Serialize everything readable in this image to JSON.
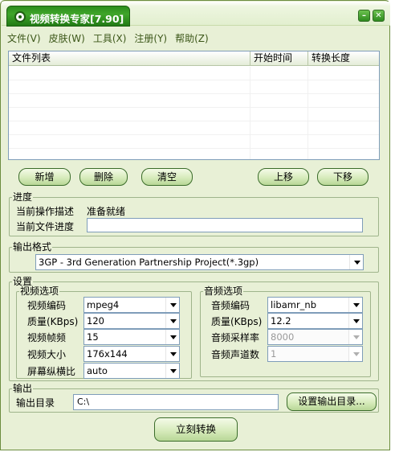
{
  "window": {
    "title": "视频转换专家[7.90]",
    "minimize_icon": "minimize-icon",
    "close_icon": "close-icon"
  },
  "menu": [
    "文件(V)",
    "皮肤(W)",
    "工具(X)",
    "注册(Y)",
    "帮助(Z)"
  ],
  "file_list": {
    "columns": [
      "文件列表",
      "开始时间",
      "转换长度"
    ],
    "rows": []
  },
  "list_buttons": {
    "add": "新增",
    "delete": "删除",
    "clear": "清空",
    "move_up": "上移",
    "move_down": "下移"
  },
  "progress": {
    "group_label": "进度",
    "op_label": "当前操作描述",
    "op_value": "准备就绪",
    "file_progress_label": "当前文件进度",
    "file_progress_value": ""
  },
  "output_format": {
    "group_label": "输出格式",
    "selected": "3GP - 3rd Generation Partnership Project(*.3gp)"
  },
  "settings": {
    "group_label": "设置",
    "video": {
      "group_label": "视频选项",
      "fields": [
        {
          "label": "视频编码",
          "value": "mpeg4"
        },
        {
          "label": "质量(KBps)",
          "value": "120"
        },
        {
          "label": "视频帧频",
          "value": "15"
        },
        {
          "label": "视频大小",
          "value": "176x144"
        },
        {
          "label": "屏幕纵横比",
          "value": "auto"
        }
      ]
    },
    "audio": {
      "group_label": "音频选项",
      "fields": [
        {
          "label": "音频编码",
          "value": "libamr_nb",
          "enabled": true
        },
        {
          "label": "质量(KBps)",
          "value": "12.2",
          "enabled": true
        },
        {
          "label": "音频采样率",
          "value": "8000",
          "enabled": false
        },
        {
          "label": "音频声道数",
          "value": "1",
          "enabled": false
        }
      ]
    }
  },
  "output": {
    "group_label": "输出",
    "dir_label": "输出目录",
    "dir_value": "C:\\",
    "set_dir_button": "设置输出目录..."
  },
  "convert_button": "立刻转换"
}
